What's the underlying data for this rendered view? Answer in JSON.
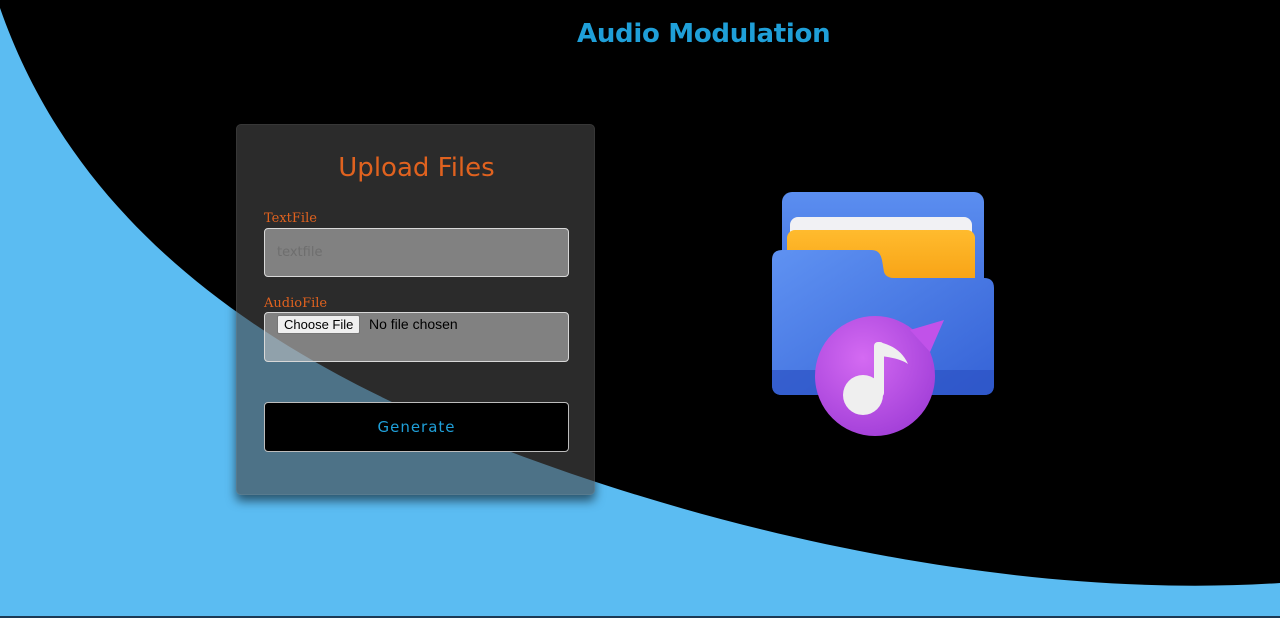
{
  "page": {
    "title": "Audio Modulation"
  },
  "colors": {
    "background_black": "#000000",
    "background_blue": "#5bbcf2",
    "title_blue": "#1f9fd8",
    "accent_orange": "#e0621f",
    "card_bg": "rgba(70,70,70,0.62)"
  },
  "upload_card": {
    "title": "Upload Files",
    "text_file": {
      "label": "TextFile",
      "placeholder": "textfile",
      "value": ""
    },
    "audio_file": {
      "label": "AudioFile",
      "button_label": "Choose File",
      "status": "No file chosen"
    },
    "generate_button": "Generate"
  },
  "illustration": {
    "icon": "music-folder-icon"
  }
}
